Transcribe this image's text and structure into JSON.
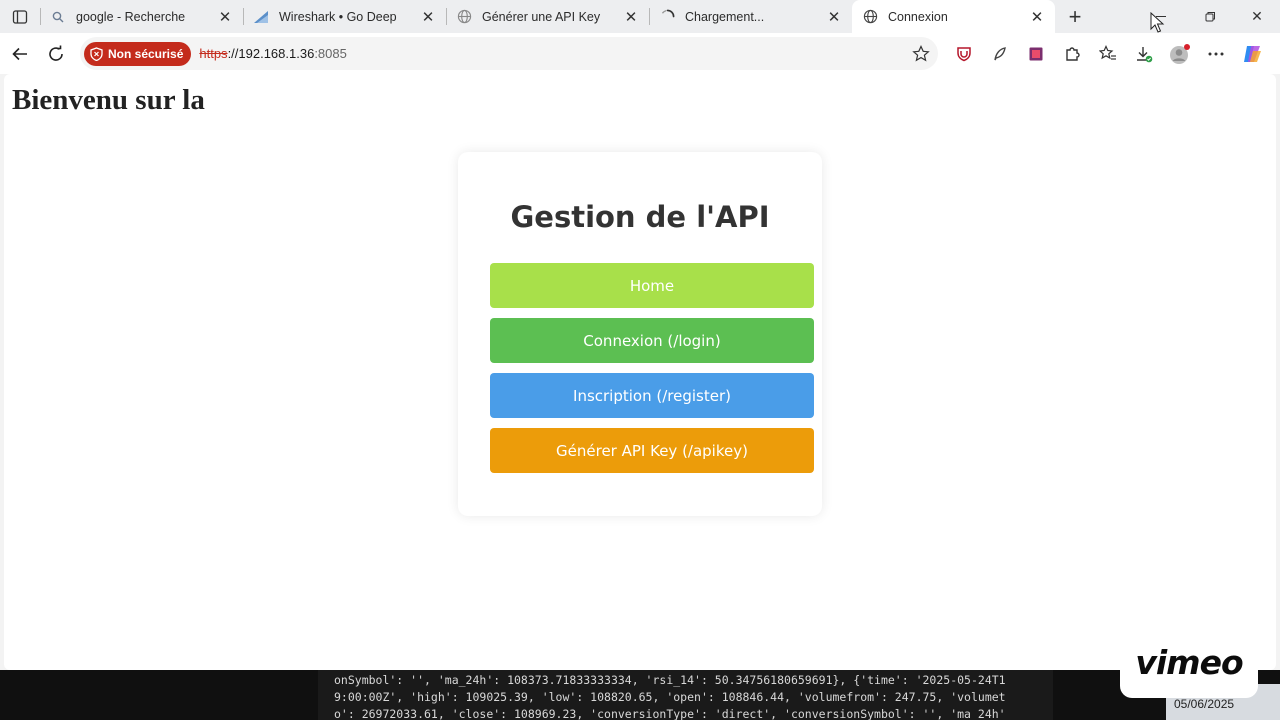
{
  "browser": {
    "tabs": [
      {
        "title": "google - Recherche",
        "icon": "search-icon"
      },
      {
        "title": "Wireshark • Go Deep",
        "icon": "wireshark-fin-icon"
      },
      {
        "title": "Générer une API Key",
        "icon": "globe-icon"
      },
      {
        "title": "Chargement...",
        "icon": "loading-spinner-icon"
      },
      {
        "title": "Connexion",
        "icon": "globe-icon",
        "active": true
      }
    ],
    "security_label": "Non sécurisé",
    "url_scheme": "https",
    "url_host": "://192.168.1.36",
    "url_port": ":8085"
  },
  "page": {
    "heading": "Bienvenu sur la",
    "card_title": "Gestion de l'API",
    "buttons": [
      {
        "label": "Home",
        "color": "#a8e04a"
      },
      {
        "label": "Connexion (/login)",
        "color": "#5cbf52"
      },
      {
        "label": "Inscription (/register)",
        "color": "#4a9de8"
      },
      {
        "label": "Générer API Key (/apikey)",
        "color": "#ec9c0a"
      }
    ]
  },
  "terminal": {
    "line1": "onSymbol': '', 'ma_24h': 108373.71833333334, 'rsi_14': 50.34756180659691}, {'time': '2025-05-24T1",
    "line2": "9:00:00Z', 'high': 109025.39, 'low': 108820.65, 'open': 108846.44, 'volumefrom': 247.75, 'volumet",
    "line3": "o': 26972033.61, 'close': 108969.23, 'conversionType': 'direct', 'conversionSymbol': '', 'ma_24h'"
  },
  "overlay": {
    "brand": "vimeo",
    "date": "05/06/2025"
  }
}
